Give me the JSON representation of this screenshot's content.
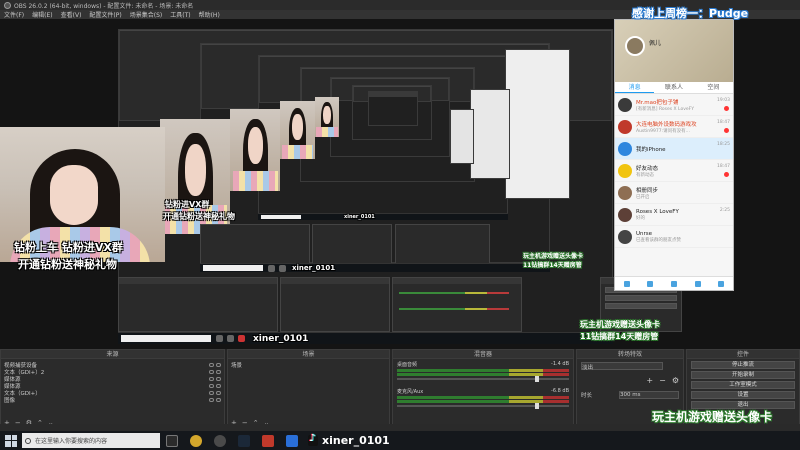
{
  "window": {
    "title": "OBS 26.0.2 (64-bit, windows) - 配置文件: 未命名 - 场景: 未命名",
    "menu": [
      "文件(F)",
      "编辑(E)",
      "查看(V)",
      "配置文件(P)",
      "场景集合(S)",
      "工具(T)",
      "帮助(H)"
    ]
  },
  "overlay": {
    "caption_line1": "钻粉上车 钻粉进VX群",
    "caption_line2": "开通钻粉送神秘礼物",
    "caption_mid1": "钻粉进VX群",
    "caption_mid2": "开通钻粉送神秘礼物",
    "thanks_banner": "感谢上周榜一：Pudge",
    "promo_line1": "玩主机游戏赠送头像卡",
    "promo_line2": "11钻搞群14天赠房管",
    "watermark_handle": "xiner_0101"
  },
  "chat": {
    "nickname": "佩儿",
    "tabs": [
      "消息",
      "联系人",
      "空间"
    ],
    "contacts": [
      {
        "name": "Mr.mao把包子铺",
        "preview": "[有新消息] Roses X LoveFY",
        "time": "19:03",
        "color": "#3a3a3a",
        "red": true,
        "badge": true
      },
      {
        "name": "大连电脑外设数码游戏攻",
        "preview": "Austin9977:请问有没有...",
        "time": "18:47",
        "color": "#c0392b",
        "red": true,
        "badge": true
      },
      {
        "name": "我的iPhone",
        "preview": "",
        "time": "18:25",
        "color": "#2e86de",
        "red": false,
        "badge": false,
        "selected": true
      },
      {
        "name": "好友动态",
        "preview": "有新动态",
        "time": "18:47",
        "color": "#f1c40f",
        "red": false,
        "badge": true
      },
      {
        "name": "相册同步",
        "preview": "已开启",
        "time": "",
        "color": "#8e6e53",
        "red": false,
        "badge": false
      },
      {
        "name": "Roses X LoveFY",
        "preview": "好的",
        "time": "2:25",
        "color": "#5d4037",
        "red": false,
        "badge": false
      },
      {
        "name": "Unrse",
        "preview": "已查看该群的朋友点赞",
        "time": "",
        "color": "#444",
        "red": false,
        "badge": false
      }
    ]
  },
  "docks": {
    "scenes_title": "场景",
    "sources_title": "来源",
    "mixer_title": "混音器",
    "transitions_title": "转场特效",
    "controls_title": "控件",
    "sources": [
      "视频捕获设备",
      "文本（GDI+）2",
      "媒体源",
      "媒体源",
      "文本（GDI+）",
      "图像"
    ],
    "scenes": [
      "场景"
    ],
    "mixer": [
      {
        "name": "桌面音频",
        "db": "-1.4 dB"
      },
      {
        "name": "麦克风/Aux",
        "db": "-6.8 dB"
      }
    ],
    "transition_type": "淡出",
    "duration_label": "时长",
    "duration_value": "300 ms",
    "controls": [
      "停止推流",
      "开始录制",
      "工作室模式",
      "设置",
      "退出"
    ]
  },
  "taskbar": {
    "search_placeholder": "在这里输入你要搜索的内容",
    "handle": "xiner_0101"
  }
}
